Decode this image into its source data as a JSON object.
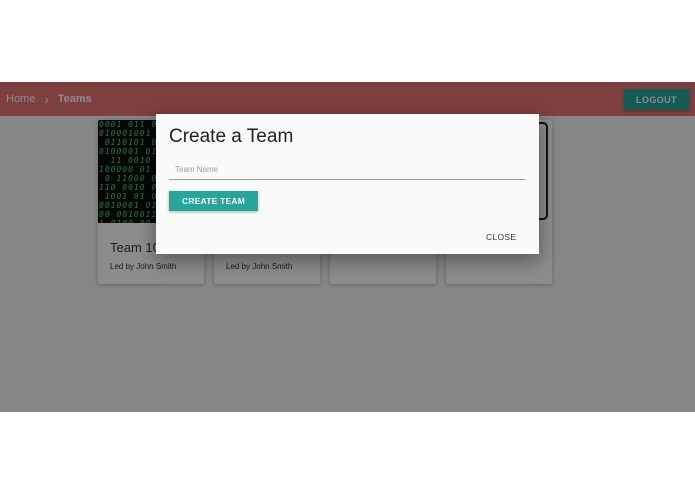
{
  "navbar": {
    "breadcrumb": {
      "home": "Home",
      "separator": "›",
      "current": "Teams"
    },
    "logout_label": "LOGOUT",
    "colors": {
      "bar": "#e57373",
      "accent": "#26a69a"
    }
  },
  "cards": [
    {
      "title": "Team 10",
      "leader": "Led by John Smith",
      "image": "binary-matrix-image"
    },
    {
      "title": "",
      "leader": "Led by John Smith",
      "image": ""
    },
    {
      "title": "",
      "leader": "",
      "image": ""
    },
    {
      "title": "",
      "leader": "",
      "image": "framed-image"
    }
  ],
  "modal": {
    "title": "Create a Team",
    "team_name_placeholder": "Team Name",
    "team_name_value": "",
    "create_label": "CREATE TEAM",
    "close_label": "CLOSE"
  }
}
